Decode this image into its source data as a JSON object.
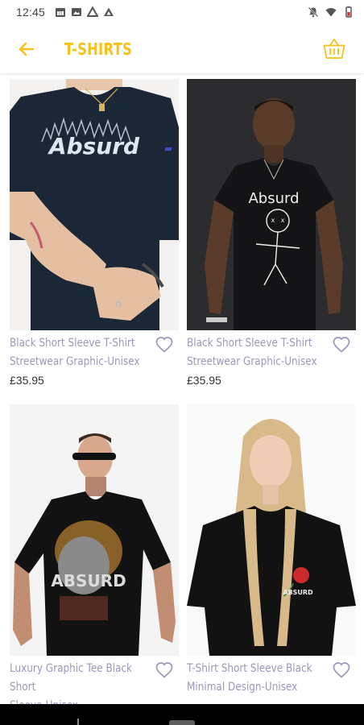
{
  "status_bar": {
    "time": "12:45",
    "left_icons": [
      "calendar-icon",
      "image-icon",
      "drive-icon",
      "drive-icon"
    ],
    "right_icons": [
      "notifications-off-icon",
      "wifi-icon",
      "battery-icon"
    ]
  },
  "app_bar": {
    "title": "T-SHIRTS",
    "back_icon": "arrow-left-icon",
    "basket_icon": "basket-icon",
    "accent_color": "#f6c21a"
  },
  "products": [
    {
      "name_line1": "Black Short Sleeve T-Shirt",
      "name_line2": "Streetwear Graphic-Unisex",
      "price": "£35.95",
      "print_text": "Absurd"
    },
    {
      "name_line1": "Black Short Sleeve T-Shirt",
      "name_line2": "Streetwear Graphic-Unisex",
      "price": "£35.95",
      "print_text": "Absurd"
    },
    {
      "name_line1": "Luxury Graphic Tee Black Short",
      "name_line2": "Sleeve-Unisex",
      "price": "",
      "print_text": "ABSURD"
    },
    {
      "name_line1": "T-Shirt Short Sleeve Black",
      "name_line2": "Minimal Design-Unisex",
      "price": "",
      "print_text": "ABSURD"
    }
  ],
  "colors": {
    "product_name": "#9b98ba",
    "heart": "#9b98ba"
  }
}
